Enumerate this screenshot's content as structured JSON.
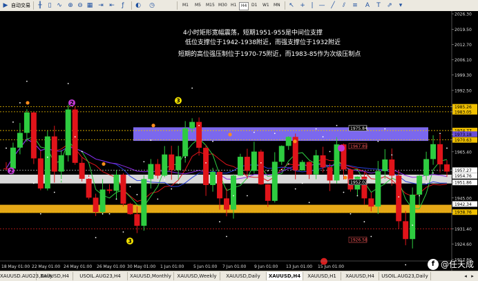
{
  "toolbar": {
    "autotrade_label": "自动交易",
    "timeframes": [
      "M1",
      "M5",
      "M15",
      "M30",
      "H1",
      "H4",
      "D1",
      "W1",
      "MN"
    ],
    "active_timeframe": "H4"
  },
  "chart": {
    "annotations": [
      "4小时矩形宽幅震荡，短期1951-955是中间位支撑",
      "低位支撑位于1942-1938附近，而强支撑位于1932附近",
      "短期的高位强压制位于1970-75附近，而1983-85作为次级压制点"
    ],
    "price_axis": [
      "2026.30",
      "2019.50",
      "2012.70",
      "2006.10",
      "1999.30",
      "1992.50",
      "1985.26",
      "1983.05",
      "1974.77",
      "1973.18",
      "1970.63",
      "1965.40",
      "1957.27",
      "1954.76",
      "1951.86",
      "1945.00",
      "1942.34",
      "1938.76",
      "1931.40",
      "1924.60",
      "1917.80"
    ],
    "highlighted_prices": {
      "1985.26": "#f0c000",
      "1983.05": "#f0c000",
      "1974.77": "#f0c000",
      "1973.18": "#6a4dd8",
      "1970.63": "#f0c000",
      "1957.27": "#ffffff",
      "1954.76": "#ffffff",
      "1951.86": "#ffffff",
      "1942.34": "#ffffff",
      "1938.76": "#f0c000"
    },
    "chart_labels": [
      "1975.84",
      "1967.89",
      "1952.02",
      "1926.58"
    ],
    "wave_labels": [
      "3",
      "3",
      "2",
      "2"
    ],
    "time_axis": [
      "18 May 01:00",
      "22 May 01:00",
      "24 May 01:00",
      "26 May 01:00",
      "30 May 01:00",
      "1 Jun 01:00",
      "5 Jun 01:00",
      "7 Jun 01:00",
      "9 Jun 01:00",
      "13 Jun 01:00",
      "15 Jun 01:00"
    ],
    "colors": {
      "bull": "#2ecc40",
      "bear": "#e0141a",
      "resistance_zone": "#7b68ee",
      "support_zone": "#e6a817",
      "mid_zone": "#d9d9d9"
    }
  },
  "tabs": {
    "items": [
      "XAUUSD.AUG23,Daily",
      "XAUUSD,H4",
      "USOIL.AUG23,H4",
      "XAUUSD,Monthly",
      "XAUUSD,Weekly",
      "XAUUSD,Daily",
      "XAUUSD,H4",
      "XAUUSD,H1",
      "XAUUSD,H4",
      "USOIL.AUG23,Daily"
    ],
    "active_index": 6
  },
  "watermark": {
    "logo": "f",
    "name": "@任天成"
  }
}
